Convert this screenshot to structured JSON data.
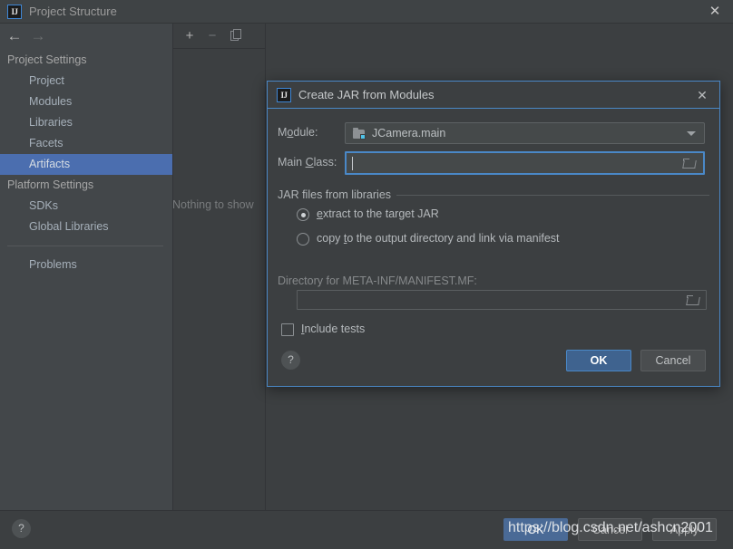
{
  "window": {
    "title": "Project Structure",
    "icon": "IJ",
    "close_label": "✕"
  },
  "nav": {
    "back_icon": "←",
    "forward_icon": "→"
  },
  "sidebar": {
    "groups": [
      {
        "label": "Project Settings"
      },
      {
        "label": "Platform Settings"
      }
    ],
    "project_items": [
      {
        "label": "Project"
      },
      {
        "label": "Modules"
      },
      {
        "label": "Libraries"
      },
      {
        "label": "Facets"
      },
      {
        "label": "Artifacts",
        "selected": true
      }
    ],
    "platform_items": [
      {
        "label": "SDKs"
      },
      {
        "label": "Global Libraries"
      }
    ],
    "problems": {
      "label": "Problems"
    }
  },
  "mid_toolbar": {
    "add_label": "+",
    "remove_label": "−",
    "copy_label": "copy-icon"
  },
  "content": {
    "empty_text": "Nothing to show"
  },
  "bottom_bar": {
    "help_label": "?",
    "ok_label": "OK",
    "cancel_label": "Cancel",
    "apply_label": "Apply"
  },
  "watermark": {
    "text": "https://blog.csdn.net/ashcn2001"
  },
  "dialog": {
    "icon": "IJ",
    "title": "Create JAR from Modules",
    "close_label": "✕",
    "module": {
      "label_pre": "M",
      "label_mnemonic": "o",
      "label_post": "dule:",
      "value": "JCamera.main",
      "icon": "module-folder-icon"
    },
    "main_class": {
      "label_pre": "Main ",
      "label_mnemonic": "C",
      "label_post": "lass:",
      "value": "",
      "browse_icon": "folder-browse-icon"
    },
    "jar_group": {
      "title": "JAR files from libraries",
      "options": [
        {
          "pre": "",
          "mnemonic": "e",
          "post": "xtract to the target JAR",
          "checked": true
        },
        {
          "pre": "copy ",
          "mnemonic": "t",
          "post": "o the output directory and link via manifest",
          "checked": false
        }
      ]
    },
    "directory": {
      "label": "Directory for META-INF/MANIFEST.MF:",
      "value": "",
      "browse_icon": "folder-browse-icon"
    },
    "include_tests": {
      "pre": "",
      "mnemonic": "I",
      "post": "nclude tests",
      "checked": false
    },
    "help_label": "?",
    "ok_label": "OK",
    "cancel_label": "Cancel"
  },
  "colors": {
    "accent_blue": "#4a88c7",
    "selection_blue": "#4b6eaf",
    "primary_button": "#3f638f",
    "panel_bg": "#3c3f41",
    "sidebar_bg": "#43474a",
    "text": "#a9b7c6"
  }
}
